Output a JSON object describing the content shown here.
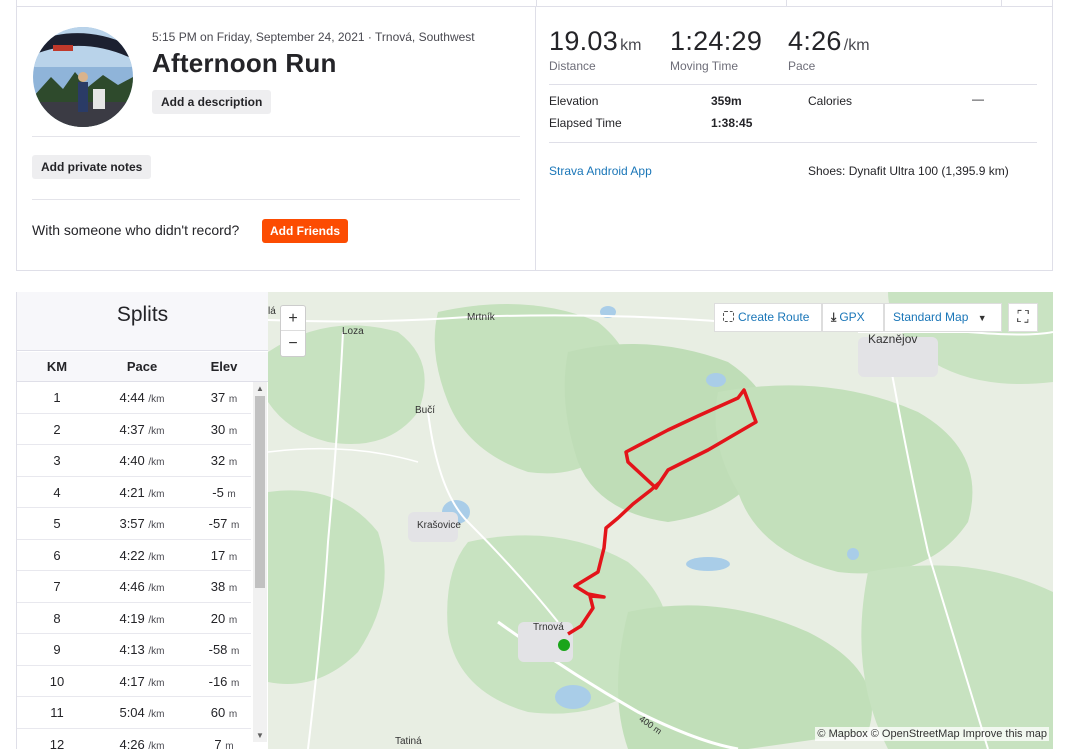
{
  "activity": {
    "meta": "5:15 PM on Friday, September 24, 2021 · Trnová, Southwest",
    "title": "Afternoon Run",
    "add_description": "Add a description",
    "add_private_notes": "Add private notes",
    "with_someone": "With someone who didn't record?",
    "add_friends": "Add Friends"
  },
  "stats": {
    "distance": {
      "value": "19.03",
      "unit": "km",
      "label": "Distance"
    },
    "moving_time": {
      "value": "1:24:29",
      "label": "Moving Time"
    },
    "pace": {
      "value": "4:26",
      "unit": "/km",
      "label": "Pace"
    },
    "elevation": {
      "label": "Elevation",
      "value": "359m"
    },
    "elapsed": {
      "label": "Elapsed Time",
      "value": "1:38:45"
    },
    "calories": {
      "label": "Calories",
      "value": "—"
    },
    "device": "Strava Android App",
    "shoes": "Shoes: Dynafit Ultra 100 (1,395.9 km)"
  },
  "splits": {
    "title": "Splits",
    "headers": [
      "KM",
      "Pace",
      "Elev"
    ],
    "pace_unit": "/km",
    "elev_unit": "m",
    "rows": [
      {
        "km": "1",
        "pace": "4:44",
        "elev": "37"
      },
      {
        "km": "2",
        "pace": "4:37",
        "elev": "30"
      },
      {
        "km": "3",
        "pace": "4:40",
        "elev": "32"
      },
      {
        "km": "4",
        "pace": "4:21",
        "elev": "-5"
      },
      {
        "km": "5",
        "pace": "3:57",
        "elev": "-57"
      },
      {
        "km": "6",
        "pace": "4:22",
        "elev": "17"
      },
      {
        "km": "7",
        "pace": "4:46",
        "elev": "38"
      },
      {
        "km": "8",
        "pace": "4:19",
        "elev": "20"
      },
      {
        "km": "9",
        "pace": "4:13",
        "elev": "-58"
      },
      {
        "km": "10",
        "pace": "4:17",
        "elev": "-16"
      },
      {
        "km": "11",
        "pace": "5:04",
        "elev": "60"
      },
      {
        "km": "12",
        "pace": "4:26",
        "elev": "7"
      }
    ]
  },
  "map": {
    "zoom_in": "+",
    "zoom_out": "−",
    "create_route": "Create Route",
    "gpx": "GPX",
    "style": "Standard Map",
    "attribution": "© Mapbox © OpenStreetMap Improve this map",
    "places": {
      "loza": "Loza",
      "mrtnik": "Mrtník",
      "kaznejov": "Kaznějov",
      "buci": "Bučí",
      "krasovice": "Krašovice",
      "trnova": "Trnová",
      "tatina": "Tatiná",
      "edge": "lá",
      "road": "400 m"
    }
  },
  "colors": {
    "accent": "#fc4c02",
    "link": "#1a76b8",
    "route": "#e3141a",
    "start": "#1aa51a"
  }
}
